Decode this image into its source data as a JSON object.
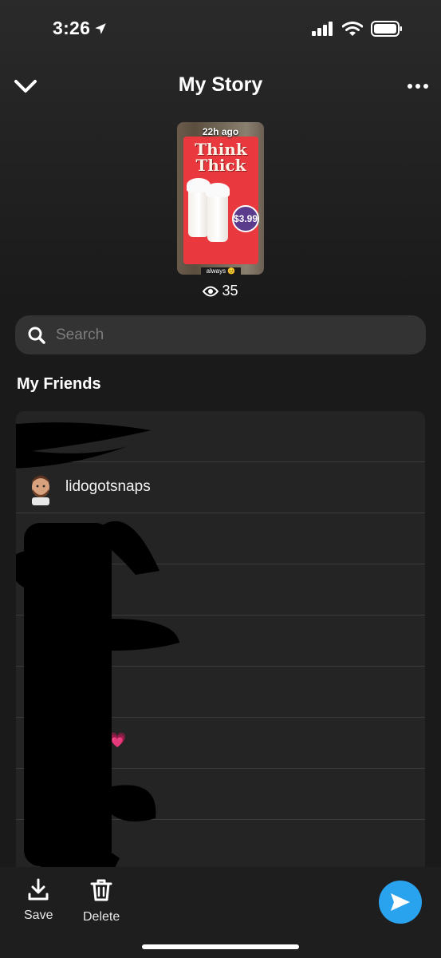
{
  "status_bar": {
    "time": "3:26"
  },
  "header": {
    "title": "My Story"
  },
  "story": {
    "time_ago": "22h ago",
    "headline_line1": "Think",
    "headline_line2": "Thick",
    "price": "$3.99",
    "caption": "always 😊",
    "views": "35"
  },
  "search": {
    "placeholder": "Search"
  },
  "friends": {
    "section_title": "My Friends",
    "rows": [
      {
        "name": ""
      },
      {
        "name": "lidogotsnaps"
      },
      {
        "name": ""
      },
      {
        "name": ""
      },
      {
        "name": ""
      },
      {
        "name": ""
      },
      {
        "name": "💗"
      },
      {
        "name": ""
      }
    ]
  },
  "actions": {
    "save_label": "Save",
    "delete_label": "Delete"
  },
  "colors": {
    "accent": "#2aa3ef",
    "background": "#1c1c1c",
    "search_bg": "#333333"
  }
}
